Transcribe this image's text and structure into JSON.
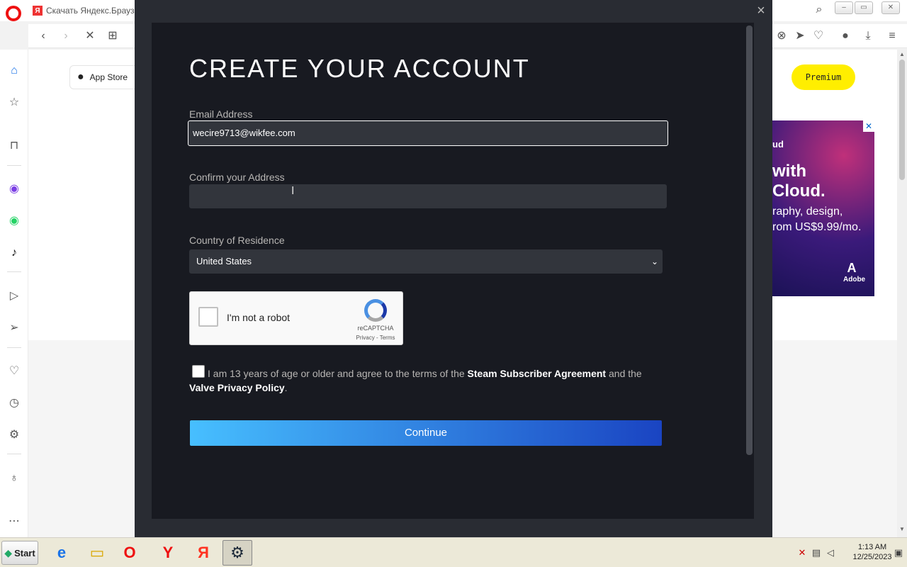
{
  "browser": {
    "tab_title": "Скачать Яндекс.Браузе",
    "tab_favicon": "Я"
  },
  "page": {
    "appstore_label": "App Store",
    "premium_label": "Premium",
    "ad": {
      "line1": "ud",
      "line2": "with",
      "line3": "Cloud.",
      "line4": "raphy, design,",
      "line5": "rom US$9.99/mo.",
      "brand": "Adobe"
    }
  },
  "modal": {
    "title": "CREATE YOUR ACCOUNT",
    "email_label": "Email Address",
    "email_value": "wecire9713@wikfee.com",
    "confirm_label": "Confirm your Address",
    "confirm_value": "",
    "country_label": "Country of Residence",
    "country_value": "United States",
    "captcha": {
      "label": "I'm not a robot",
      "brand": "reCAPTCHA",
      "links": "Privacy - Terms"
    },
    "agree": {
      "prefix": "I am 13 years of age or older and agree to the terms of the ",
      "link1": "Steam Subscriber Agreement",
      "middle": " and the ",
      "link2": "Valve Privacy Policy",
      "suffix": "."
    },
    "continue_label": "Continue"
  },
  "taskbar": {
    "start_label": "Start",
    "time": "1:13 AM",
    "date": "12/25/2023"
  },
  "colors": {
    "modal_bg": "#181a21",
    "overlay_bg": "#292c33",
    "button_gradient_start": "#47bfff",
    "button_gradient_end": "#1a44c2",
    "premium_yellow": "#ffee00"
  }
}
